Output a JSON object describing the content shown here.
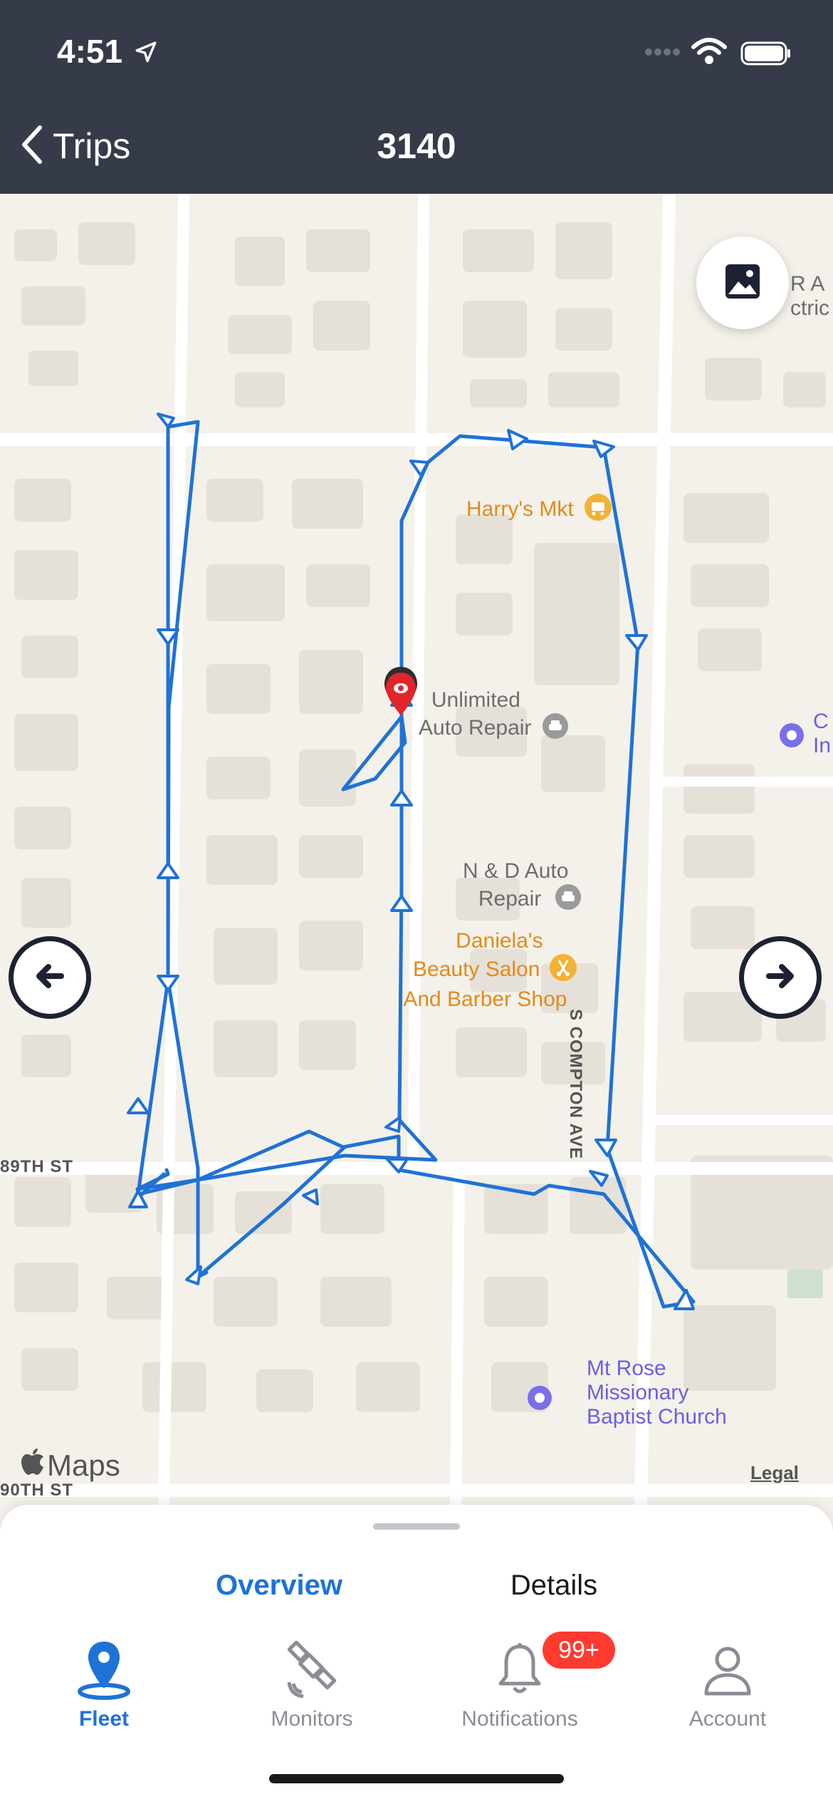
{
  "status_bar": {
    "time": "4:51"
  },
  "nav": {
    "back_label": "Trips",
    "title": "3140"
  },
  "map": {
    "pois": {
      "harrys": "Harry's Mkt",
      "unlimited_1": "Unlimited",
      "unlimited_2": "Auto Repair",
      "nd_1": "N & D Auto",
      "nd_2": "Repair",
      "daniela_1": "Daniela's",
      "daniela_2": "Beauty Salon",
      "daniela_3": "And Barber Shop",
      "mtrose_1": "Mt Rose",
      "mtrose_2": "Missionary",
      "mtrose_3": "Baptist Church",
      "partial_ra_1": "R A",
      "partial_ra_2": "ctric",
      "partial_c_1": "C",
      "partial_c_2": "In"
    },
    "streets": {
      "s89": "89TH ST",
      "s90": "90TH ST",
      "compton": "S COMPTON AVE"
    },
    "maps_brand": "Maps",
    "legal": "Legal",
    "route_color": "#1f72d6"
  },
  "sheet": {
    "tabs": [
      {
        "label": "Overview",
        "active": true
      },
      {
        "label": "Details",
        "active": false
      }
    ]
  },
  "bottom_nav": {
    "items": [
      {
        "label": "Fleet",
        "icon": "map-pin-icon",
        "active": true
      },
      {
        "label": "Monitors",
        "icon": "satellite-icon",
        "active": false
      },
      {
        "label": "Notifications",
        "icon": "bell-icon",
        "active": false
      },
      {
        "label": "Account",
        "icon": "person-icon",
        "active": false
      }
    ],
    "notifications_badge": "99+"
  },
  "colors": {
    "header_bg": "#363b49",
    "accent": "#1f72d6",
    "badge": "#ff3b30"
  }
}
